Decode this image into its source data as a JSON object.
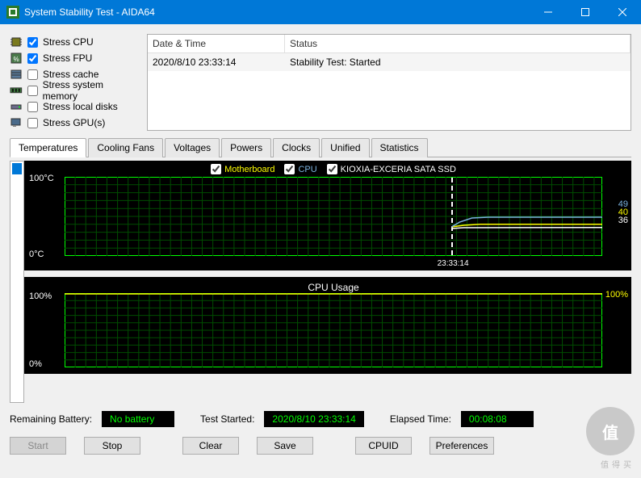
{
  "window": {
    "title": "System Stability Test - AIDA64"
  },
  "stress": [
    {
      "label": "Stress CPU",
      "checked": true
    },
    {
      "label": "Stress FPU",
      "checked": true
    },
    {
      "label": "Stress cache",
      "checked": false
    },
    {
      "label": "Stress system memory",
      "checked": false
    },
    {
      "label": "Stress local disks",
      "checked": false
    },
    {
      "label": "Stress GPU(s)",
      "checked": false
    }
  ],
  "log": {
    "headers": {
      "datetime": "Date & Time",
      "status": "Status"
    },
    "rows": [
      {
        "datetime": "2020/8/10 23:33:14",
        "status": "Stability Test: Started"
      }
    ]
  },
  "tabs": [
    "Temperatures",
    "Cooling Fans",
    "Voltages",
    "Powers",
    "Clocks",
    "Unified",
    "Statistics"
  ],
  "active_tab": "Temperatures",
  "temp_chart": {
    "legend": [
      {
        "label": "Motherboard",
        "color": "#ffff00",
        "checked": true
      },
      {
        "label": "CPU",
        "color": "#7bb3e0",
        "checked": true
      },
      {
        "label": "KIOXIA-EXCERIA SATA SSD",
        "color": "#ffffff",
        "checked": true
      }
    ],
    "y_top": "100°C",
    "y_bottom": "0°C",
    "time_marker": "23:33:14",
    "values": {
      "mb": 40,
      "cpu": 49,
      "ssd": 36
    }
  },
  "cpu_chart": {
    "title": "CPU Usage",
    "y_top": "100%",
    "y_bottom": "0%",
    "value_label": "100%"
  },
  "status": {
    "battery_label": "Remaining Battery:",
    "battery_value": "No battery",
    "started_label": "Test Started:",
    "started_value": "2020/8/10 23:33:14",
    "elapsed_label": "Elapsed Time:",
    "elapsed_value": "00:08:08"
  },
  "buttons": {
    "start": "Start",
    "stop": "Stop",
    "clear": "Clear",
    "save": "Save",
    "cpuid": "CPUID",
    "preferences": "Preferences"
  },
  "chart_data": [
    {
      "type": "line",
      "title": "Temperatures",
      "ylabel": "°C",
      "ylim": [
        0,
        100
      ],
      "x_marker": "23:33:14",
      "series": [
        {
          "name": "Motherboard",
          "current": 40,
          "color": "#ffff00"
        },
        {
          "name": "CPU",
          "current": 49,
          "color": "#7bb3e0"
        },
        {
          "name": "KIOXIA-EXCERIA SATA SSD",
          "current": 36,
          "color": "#ffffff"
        }
      ]
    },
    {
      "type": "line",
      "title": "CPU Usage",
      "ylabel": "%",
      "ylim": [
        0,
        100
      ],
      "series": [
        {
          "name": "CPU Usage",
          "current": 100,
          "color": "#ffff00"
        }
      ]
    }
  ]
}
